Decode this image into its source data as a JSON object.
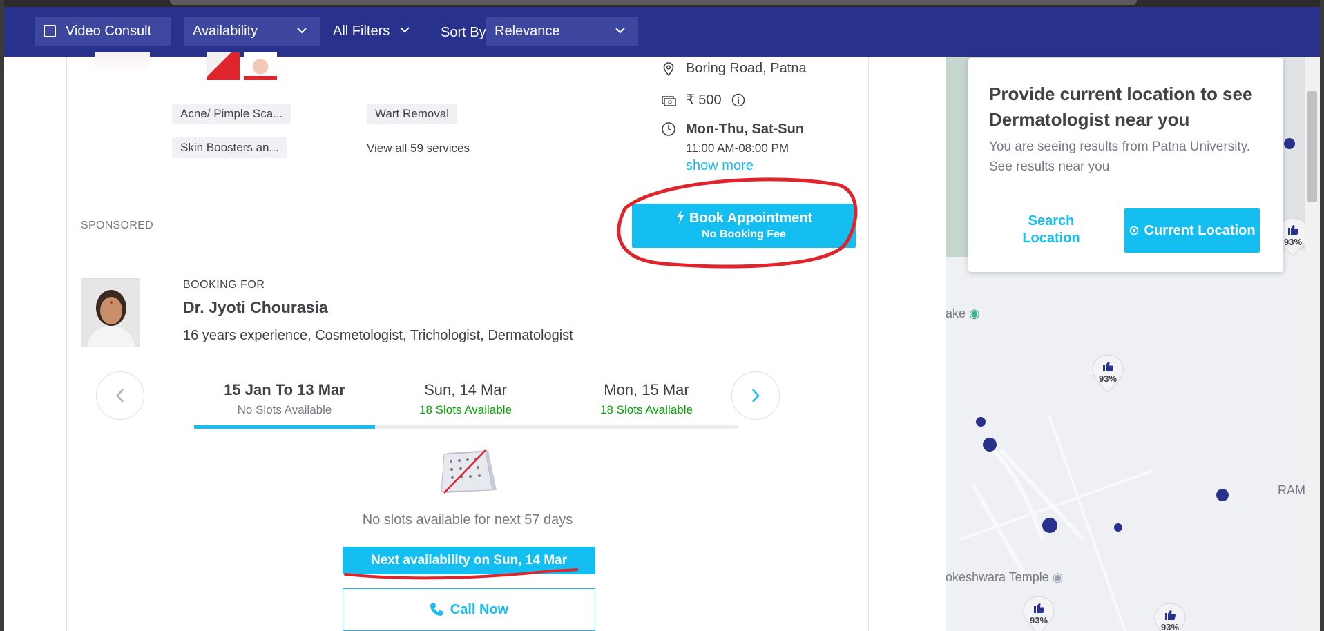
{
  "navbar": {
    "video_consult": "Video Consult",
    "availability": "Availability",
    "all_filters": "All Filters",
    "sort_by_label": "Sort By",
    "sort_value": "Relevance"
  },
  "card": {
    "services": [
      "Acne/ Pimple Sca...",
      "Wart Removal",
      "Skin Boosters an..."
    ],
    "view_all": "View all 59 services",
    "location": "Boring Road, Patna",
    "fee": "₹ 500",
    "days": "Mon-Thu, Sat-Sun",
    "hours": "11:00 AM-08:00 PM",
    "show_more": "show more",
    "sponsored": "SPONSORED",
    "book_btn": {
      "line1": "Book Appointment",
      "line2": "No Booking Fee"
    }
  },
  "booking": {
    "label": "BOOKING FOR",
    "doctor_name": "Dr. Jyoti Chourasia",
    "description": "16 years experience, Cosmetologist, Trichologist, Dermatologist",
    "dates": [
      {
        "date": "15 Jan To 13 Mar",
        "slots": "No Slots Available",
        "status_color": "#787887"
      },
      {
        "date": "Sun, 14 Mar",
        "slots": "18 Slots Available",
        "status_color": "#01a400"
      },
      {
        "date": "Mon, 15 Mar",
        "slots": "18 Slots Available",
        "status_color": "#01a400"
      }
    ],
    "no_slots_msg": "No slots available for next 57 days",
    "next_availability": "Next availability on Sun, 14 Mar",
    "call_now": "Call Now"
  },
  "location_popup": {
    "title": "Provide current location to see Dermatologist near you",
    "subtitle": "You are seeing results from Patna University. See results near you",
    "search_location": "Search Location",
    "current_location": "Current Location"
  },
  "map": {
    "labels": [
      "ake",
      "RAM",
      "okeshwara Temple"
    ],
    "pins": [
      "93%",
      "93%",
      "93%",
      "93%",
      "93%"
    ]
  },
  "colors": {
    "brand_navy": "#28328c",
    "accent_blue": "#14bef0",
    "annotation_red": "#e0242c"
  },
  "icons": [
    "location-pin-icon",
    "money-icon",
    "info-icon",
    "clock-icon",
    "lightning-icon",
    "phone-icon",
    "chevron-left-icon",
    "chevron-right-icon",
    "crosshair-icon",
    "calendar-no-slot-icon",
    "thumbs-up-icon"
  ]
}
